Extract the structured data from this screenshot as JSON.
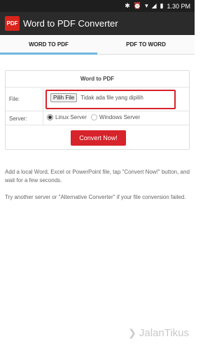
{
  "status_bar": {
    "icons": [
      "bluetooth-icon",
      "alarm-icon",
      "wifi-icon",
      "signal-icon",
      "battery-icon"
    ],
    "time": "1.30 PM"
  },
  "app_bar": {
    "logo_text": "PDF",
    "title": "Word to PDF Converter"
  },
  "tabs": [
    {
      "label": "WORD TO PDF",
      "active": true
    },
    {
      "label": "PDF TO WORD",
      "active": false
    }
  ],
  "panel": {
    "title": "Word to PDF",
    "file_label": "File:",
    "file_button": "Pilih File",
    "file_status": "Tidak ada file yang dipilih",
    "server_label": "Server:",
    "server_options": [
      {
        "label": "Linux Server",
        "selected": true
      },
      {
        "label": "Windows Server",
        "selected": false
      }
    ],
    "convert_button": "Convert Now!"
  },
  "help": {
    "line1": "Add a local Word, Excel or PowerPoint file, tap \"Convert Now!\" button, and wait for a few seconds.",
    "line2": "Try another server or \"Alternative Converter\" if your file conversion failed."
  },
  "watermark": {
    "text": "JalanTikus"
  },
  "colors": {
    "accent_red": "#d7232b",
    "tab_indicator": "#6fb7e0",
    "app_bar": "#2b2b2b"
  }
}
